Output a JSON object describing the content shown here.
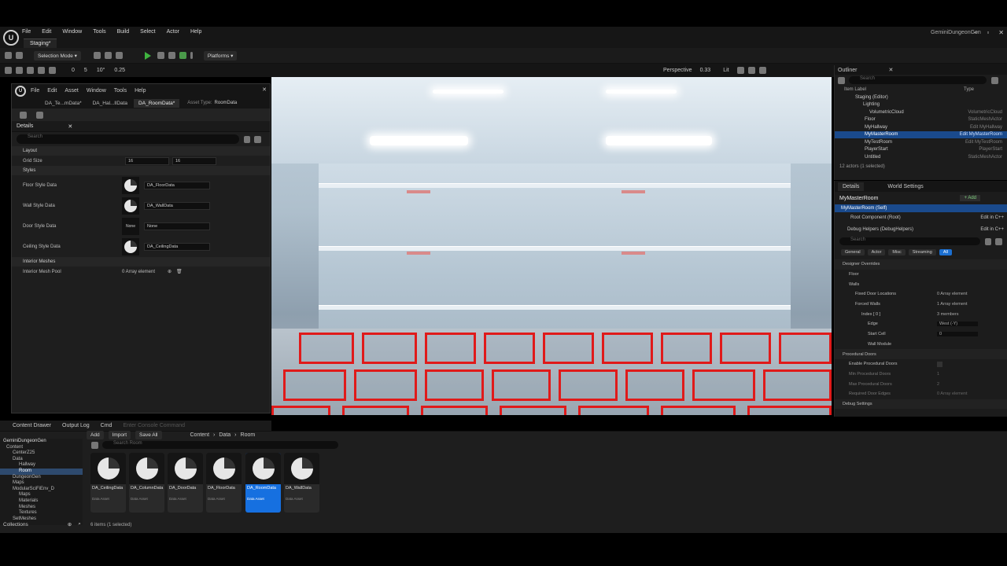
{
  "app": {
    "project_name": "GeminiDungeonGen",
    "menu": [
      "File",
      "Edit",
      "Window",
      "Tools",
      "Build",
      "Select",
      "Actor",
      "Help"
    ],
    "level_tab": "Staging*"
  },
  "toolbar": {
    "selection_mode": "Selection Mode",
    "platforms": "Platforms"
  },
  "viewport_toolbar": {
    "perspective": "Perspective",
    "fov_value": "0.33",
    "lit": "Lit",
    "grid_values": [
      "0",
      "5",
      "10°",
      "0.25"
    ]
  },
  "asset_editor": {
    "menu": [
      "File",
      "Edit",
      "Asset",
      "Window",
      "Tools",
      "Help"
    ],
    "tabs": [
      "DA_Te...mData*",
      "DA_Hal...llData",
      "DA_RoomData*"
    ],
    "asset_type_label": "Asset Type:",
    "asset_type_value": "RoomData",
    "details_title": "Details",
    "search_placeholder": "Search",
    "layout_section": "Layout",
    "grid_size_label": "Grid Size",
    "grid_size_x": "16",
    "grid_size_y": "16",
    "styles_section": "Styles",
    "styles": [
      {
        "label": "Floor Style Data",
        "value": "DA_FloorData"
      },
      {
        "label": "Wall Style Data",
        "value": "DA_WallData"
      },
      {
        "label": "Door Style Data",
        "value": "None",
        "thumb": "None"
      },
      {
        "label": "Ceiling Style Data",
        "value": "DA_CeilingData"
      }
    ],
    "interior_section": "Interior Meshes",
    "interior_mesh_label": "Interior Mesh Pool",
    "interior_mesh_value": "0 Array element"
  },
  "outliner": {
    "title": "Outliner",
    "search_placeholder": "Search",
    "col_label": "Item Label",
    "col_type": "Type",
    "rows": [
      {
        "label": "Staging (Editor)",
        "type": ""
      },
      {
        "label": "Lighting",
        "type": ""
      },
      {
        "label": "VolumetricCloud",
        "type": "VolumetricCloud"
      },
      {
        "label": "Floor",
        "type": "StaticMeshActor"
      },
      {
        "label": "MyHallway",
        "type": "Edit MyHallway"
      },
      {
        "label": "MyMasterRoom",
        "type": "Edit MyMasterRoom",
        "selected": true
      },
      {
        "label": "MyTestRoom",
        "type": "Edit MyTestRoom"
      },
      {
        "label": "PlayerStart",
        "type": "PlayerStart"
      },
      {
        "label": "Untitled",
        "type": "StaticMeshActor"
      }
    ],
    "footer": "12 actors (1 selected)"
  },
  "details": {
    "tab_details": "Details",
    "tab_world": "World Settings",
    "actor_name": "MyMasterRoom",
    "add_label": "+ Add",
    "components": [
      {
        "label": "MyMasterRoom (Self)",
        "action": ""
      },
      {
        "label": "Root Component (Root)",
        "action": "Edit in C++"
      },
      {
        "label": "Debug Helpers (DebugHelpers)",
        "action": "Edit in C++"
      }
    ],
    "search_placeholder": "Search",
    "categories": [
      "General",
      "Actor",
      "Misc",
      "Streaming",
      "All"
    ],
    "props": [
      {
        "label": "Designer Overrides",
        "value": "",
        "indent": 0
      },
      {
        "label": "Floor",
        "value": "",
        "indent": 1
      },
      {
        "label": "Walls",
        "value": "",
        "indent": 1
      },
      {
        "label": "Fixed Door Locations",
        "value": "0 Array element",
        "indent": 2
      },
      {
        "label": "Forced Walls",
        "value": "1 Array element",
        "indent": 2
      },
      {
        "label": "Index [ 0 ]",
        "value": "3 members",
        "indent": 3
      },
      {
        "label": "Edge",
        "value": "West (-Y)",
        "indent": 4
      },
      {
        "label": "Start Cell",
        "value": "0",
        "indent": 4
      },
      {
        "label": "Wall Module",
        "value": "",
        "indent": 4
      },
      {
        "label": "Procedural Doors",
        "value": "",
        "indent": 0
      },
      {
        "label": "Enable Procedural Doors",
        "value": "",
        "indent": 1
      },
      {
        "label": "Min Procedural Doors",
        "value": "1",
        "indent": 1
      },
      {
        "label": "Max Procedural Doors",
        "value": "2",
        "indent": 1
      },
      {
        "label": "Required Door Edges",
        "value": "0 Array element",
        "indent": 1
      },
      {
        "label": "Debug Settings",
        "value": "",
        "indent": 0
      }
    ]
  },
  "content_drawer": {
    "bar_items": [
      "Content Drawer",
      "Output Log",
      "Cmd"
    ],
    "console_placeholder": "Enter Console Command",
    "buttons": [
      "Add",
      "Import",
      "Save All"
    ],
    "path": [
      "Content",
      "Data",
      "Room"
    ],
    "search_placeholder": "Search Room",
    "tree": [
      "GeminiDungeonGen",
      "Content",
      "CenterZ25",
      "Data",
      "Hallway",
      "Room",
      "DungeonGen",
      "Maps",
      "ModularSciFiEnv_D",
      "Maps",
      "Materials",
      "Meshes",
      "Textures",
      "SetMeshes"
    ],
    "assets": [
      {
        "name": "DA_CeilingData",
        "type": "Data Asset"
      },
      {
        "name": "DA_ColumnData",
        "type": "Data Asset"
      },
      {
        "name": "DA_DoorData",
        "type": "Data Asset"
      },
      {
        "name": "DA_FloorData",
        "type": "Data Asset"
      },
      {
        "name": "DA_RoomData",
        "type": "Data Asset",
        "selected": true
      },
      {
        "name": "DA_WallData",
        "type": "Data Asset"
      }
    ],
    "collections": "Collections",
    "status": "6 items (1 selected)"
  },
  "colors": {
    "accent": "#1670e0",
    "selection": "#1a4a8c",
    "grid_lines": "#e01a1a",
    "play": "#3fb33f"
  }
}
